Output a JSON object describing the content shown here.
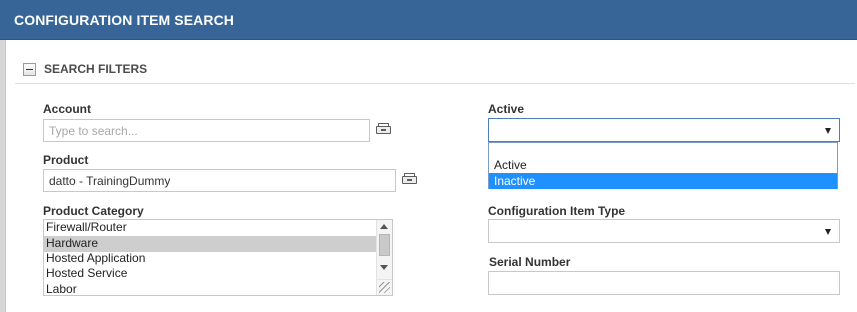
{
  "header": {
    "title": "CONFIGURATION ITEM SEARCH"
  },
  "filters": {
    "section_title": "SEARCH FILTERS",
    "account": {
      "label": "Account",
      "placeholder": "Type to search...",
      "value": ""
    },
    "product": {
      "label": "Product",
      "value": "datto - TrainingDummy"
    },
    "product_category": {
      "label": "Product Category",
      "options": [
        "Firewall/Router",
        "Hardware",
        "Hosted Application",
        "Hosted Service",
        "Labor"
      ],
      "selected": "Hardware"
    },
    "active": {
      "label": "Active",
      "value": "",
      "options": [
        "",
        "Active",
        "Inactive"
      ],
      "highlighted": "Inactive"
    },
    "configuration_item_type": {
      "label": "Configuration Item Type",
      "value": ""
    },
    "serial_number": {
      "label": "Serial Number",
      "value": ""
    }
  },
  "colors": {
    "header_bg": "#376597",
    "highlight": "#1e90ff",
    "selected_row": "#cecece"
  },
  "icons": [
    "collapse-minus-icon",
    "picker-icon",
    "chevron-down-icon",
    "resize-grip-icon"
  ]
}
